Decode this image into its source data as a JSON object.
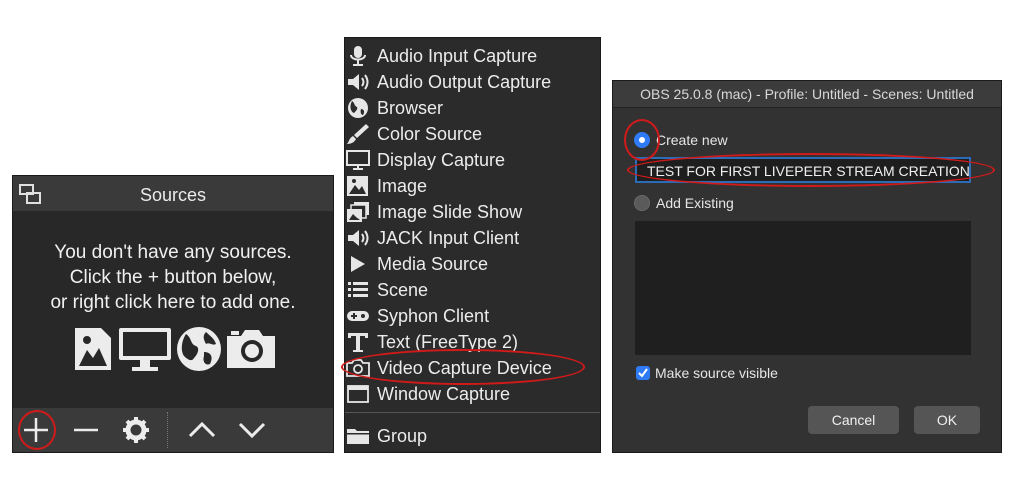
{
  "sources_panel": {
    "title": "Sources",
    "empty_message": [
      "You don't have any sources.",
      "Click the + button below,",
      "or right click here to add one."
    ],
    "placeholder_icons": [
      "image-icon",
      "display-icon",
      "globe-icon",
      "camera-icon"
    ],
    "toolbar": [
      "add-icon",
      "remove-icon",
      "gear-icon",
      "move-up-icon",
      "move-down-icon"
    ]
  },
  "add_menu": {
    "items": [
      {
        "label": "Audio Input Capture",
        "icon": "microphone-icon"
      },
      {
        "label": "Audio Output Capture",
        "icon": "speaker-icon"
      },
      {
        "label": "Browser",
        "icon": "globe-icon"
      },
      {
        "label": "Color Source",
        "icon": "brush-icon"
      },
      {
        "label": "Display Capture",
        "icon": "monitor-icon"
      },
      {
        "label": "Image",
        "icon": "image-icon"
      },
      {
        "label": "Image Slide Show",
        "icon": "slideshow-icon"
      },
      {
        "label": "JACK Input Client",
        "icon": "speaker-icon"
      },
      {
        "label": "Media Source",
        "icon": "play-icon"
      },
      {
        "label": "Scene",
        "icon": "list-icon"
      },
      {
        "label": "Syphon Client",
        "icon": "gamepad-icon"
      },
      {
        "label": "Text (FreeType 2)",
        "icon": "text-icon"
      },
      {
        "label": "Video Capture Device",
        "icon": "camera-icon"
      },
      {
        "label": "Window Capture",
        "icon": "window-icon"
      }
    ],
    "group_item": {
      "label": "Group",
      "icon": "folder-icon"
    }
  },
  "dialog": {
    "title": "OBS 25.0.8 (mac) - Profile: Untitled - Scenes: Untitled",
    "create_new_label": "Create new",
    "name_value": "TEST FOR FIRST LIVEPEER STREAM CREATION",
    "add_existing_label": "Add Existing",
    "make_visible_label": "Make source visible",
    "make_visible_checked": true,
    "cancel_label": "Cancel",
    "ok_label": "OK"
  },
  "colors": {
    "annotation": "#d11a1a",
    "accent": "#2f7bf6"
  }
}
